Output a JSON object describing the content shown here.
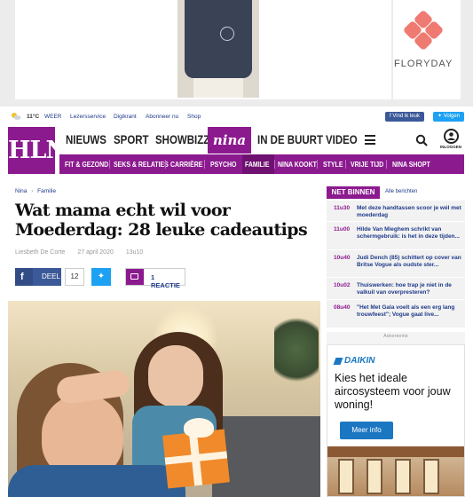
{
  "top_ad": {
    "brand": "FLORYDAY"
  },
  "utility": {
    "temperature": "11°C",
    "links": [
      "WEER",
      "Lezersservice",
      "Digikrant",
      "Abonneer nu",
      "Shop"
    ],
    "facebook_label": "Vind ik leuk",
    "twitter_label": "Volgen"
  },
  "header": {
    "logo": "HLN",
    "nav": [
      "NIEUWS",
      "SPORT",
      "SHOWBIZZ",
      "nina",
      "IN DE BUURT",
      "VIDEO"
    ],
    "login_label": "INLOGGEN",
    "subnav": [
      "FIT & GEZOND",
      "SEKS & RELATIES",
      "CARRIÈRE",
      "PSYCHO",
      "FAMILIE",
      "NINA KOOKT",
      "STYLE",
      "VRIJE TIJD",
      "NINA SHOPT"
    ],
    "subnav_active": "FAMILIE",
    "accent": "#8c1a8f"
  },
  "article": {
    "breadcrumb": [
      "Nina",
      "Familie"
    ],
    "title": "Wat mama echt wil voor Moederdag: 28 leuke cadeautips",
    "author": "Liesbeth De Corte",
    "date": "27 april 2020",
    "time": "13u10",
    "share_label": "DEEL",
    "share_count": "12",
    "reactions_label": "1 REACTIE"
  },
  "sidebar": {
    "net_binnen": "NET BINNEN",
    "all_articles": "Alle berichten",
    "items": [
      {
        "time": "11u30",
        "text": "Met deze handtassen scoor je wél met moederdag"
      },
      {
        "time": "11u00",
        "text": "Hilde Van Mieghem schrikt van schermgebruik: is het in deze tijden..."
      },
      {
        "time": "10u40",
        "text": "Judi Dench (85) schittert op cover van Britse Vogue als oudste ster..."
      },
      {
        "time": "10u02",
        "text": "Thuiswerken: hoe trap je niet in de valkuil van overpresteren?"
      },
      {
        "time": "08u40",
        "text": "\"Het Met Gala voelt als een erg lang trouwfeest\"; Vogue gaat live..."
      }
    ]
  },
  "side_ad": {
    "label": "Advertentie",
    "brand": "DAIKIN",
    "headline": "Kies het ideale aircosysteem voor jouw woning!",
    "cta": "Meer info"
  }
}
